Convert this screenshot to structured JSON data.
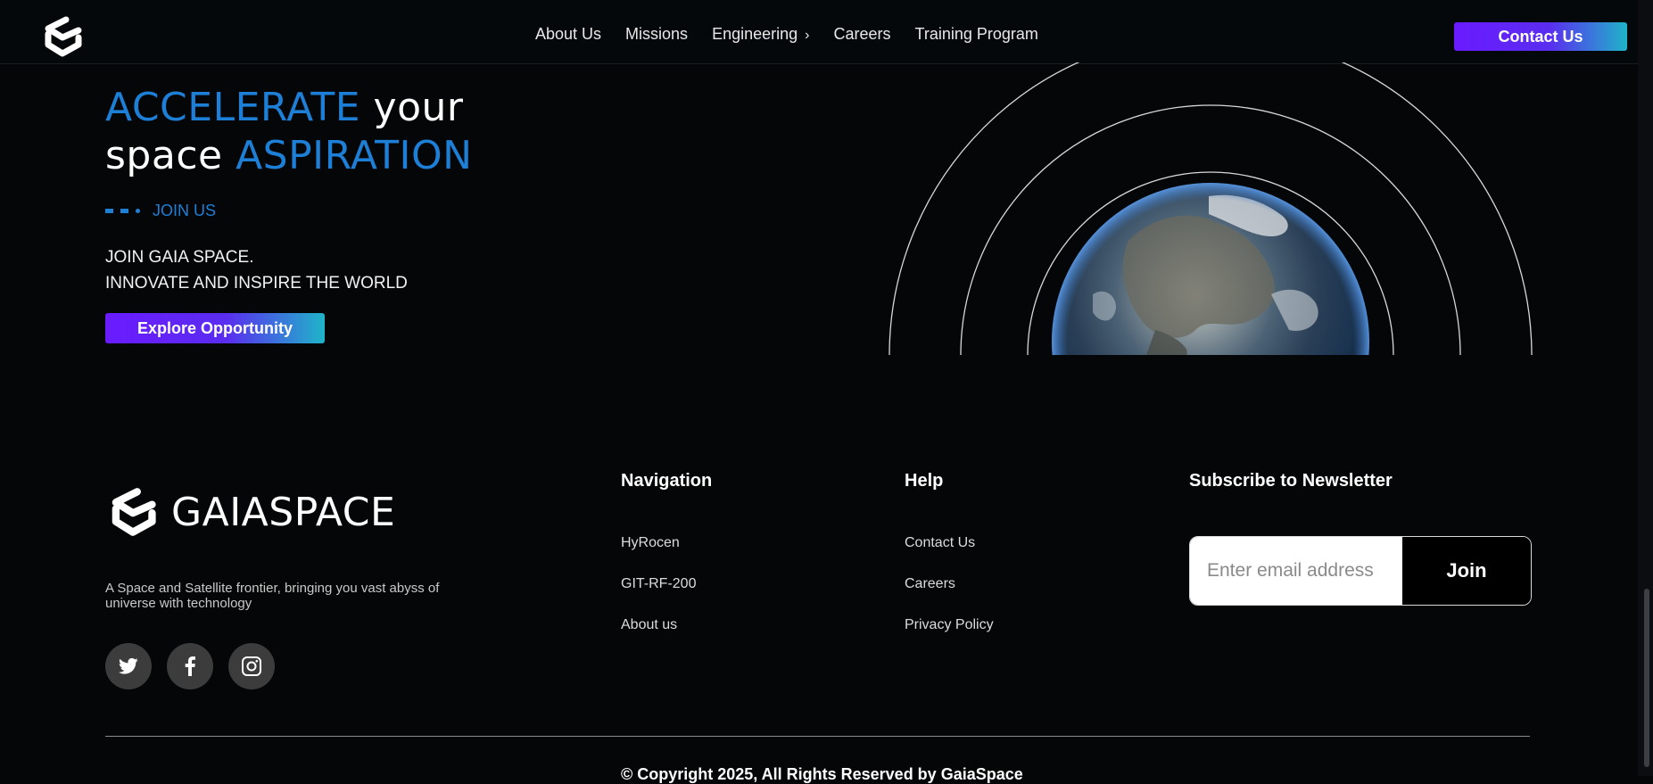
{
  "header": {
    "nav": [
      "About Us",
      "Missions",
      "Engineering",
      "Careers",
      "Training Program"
    ],
    "engineering_chevron": "›",
    "contact_label": "Contact Us"
  },
  "hero": {
    "line1_a": "ACCELERATE",
    "line1_b": " your",
    "line2_a": "space ",
    "line2_b": "ASPIRATION",
    "join_us": "JOIN US",
    "headline1": "JOIN GAIA SPACE.",
    "headline2": "INNOVATE AND INSPIRE THE WORLD",
    "cta": "Explore Opportunity"
  },
  "footer": {
    "brand": "GAIASPACE",
    "tagline": "A Space and Satellite frontier, bringing you vast abyss of universe with technology",
    "socials": [
      "twitter-icon",
      "facebook-icon",
      "instagram-icon"
    ],
    "navigation": {
      "title": "Navigation",
      "links": [
        "HyRocen",
        "GIT-RF-200",
        "About us"
      ]
    },
    "help": {
      "title": "Help",
      "links": [
        "Contact Us",
        "Careers",
        "Privacy Policy"
      ]
    },
    "newsletter": {
      "title": "Subscribe to Newsletter",
      "placeholder": "Enter email address",
      "button": "Join"
    },
    "copyright": "© Copyright 2025, All Rights Reserved by GaiaSpace"
  },
  "colors": {
    "accent_blue": "#1d7fd6",
    "gradient_start": "#6a1bff",
    "gradient_end": "#1fb4c9",
    "background": "#040608"
  }
}
